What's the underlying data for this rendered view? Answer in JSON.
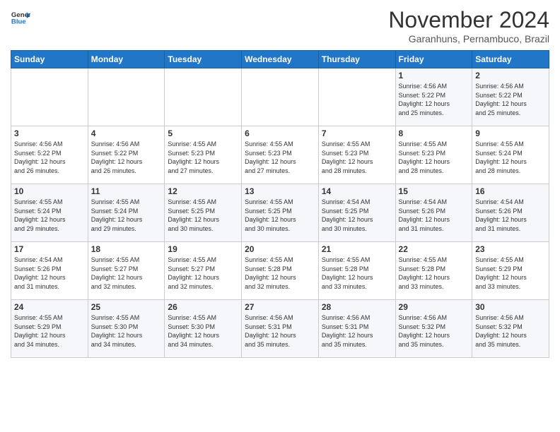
{
  "header": {
    "logo_line1": "General",
    "logo_line2": "Blue",
    "month": "November 2024",
    "location": "Garanhuns, Pernambuco, Brazil"
  },
  "weekdays": [
    "Sunday",
    "Monday",
    "Tuesday",
    "Wednesday",
    "Thursday",
    "Friday",
    "Saturday"
  ],
  "weeks": [
    [
      {
        "day": "",
        "info": ""
      },
      {
        "day": "",
        "info": ""
      },
      {
        "day": "",
        "info": ""
      },
      {
        "day": "",
        "info": ""
      },
      {
        "day": "",
        "info": ""
      },
      {
        "day": "1",
        "info": "Sunrise: 4:56 AM\nSunset: 5:22 PM\nDaylight: 12 hours\nand 25 minutes."
      },
      {
        "day": "2",
        "info": "Sunrise: 4:56 AM\nSunset: 5:22 PM\nDaylight: 12 hours\nand 25 minutes."
      }
    ],
    [
      {
        "day": "3",
        "info": "Sunrise: 4:56 AM\nSunset: 5:22 PM\nDaylight: 12 hours\nand 26 minutes."
      },
      {
        "day": "4",
        "info": "Sunrise: 4:56 AM\nSunset: 5:22 PM\nDaylight: 12 hours\nand 26 minutes."
      },
      {
        "day": "5",
        "info": "Sunrise: 4:55 AM\nSunset: 5:23 PM\nDaylight: 12 hours\nand 27 minutes."
      },
      {
        "day": "6",
        "info": "Sunrise: 4:55 AM\nSunset: 5:23 PM\nDaylight: 12 hours\nand 27 minutes."
      },
      {
        "day": "7",
        "info": "Sunrise: 4:55 AM\nSunset: 5:23 PM\nDaylight: 12 hours\nand 28 minutes."
      },
      {
        "day": "8",
        "info": "Sunrise: 4:55 AM\nSunset: 5:23 PM\nDaylight: 12 hours\nand 28 minutes."
      },
      {
        "day": "9",
        "info": "Sunrise: 4:55 AM\nSunset: 5:24 PM\nDaylight: 12 hours\nand 28 minutes."
      }
    ],
    [
      {
        "day": "10",
        "info": "Sunrise: 4:55 AM\nSunset: 5:24 PM\nDaylight: 12 hours\nand 29 minutes."
      },
      {
        "day": "11",
        "info": "Sunrise: 4:55 AM\nSunset: 5:24 PM\nDaylight: 12 hours\nand 29 minutes."
      },
      {
        "day": "12",
        "info": "Sunrise: 4:55 AM\nSunset: 5:25 PM\nDaylight: 12 hours\nand 30 minutes."
      },
      {
        "day": "13",
        "info": "Sunrise: 4:55 AM\nSunset: 5:25 PM\nDaylight: 12 hours\nand 30 minutes."
      },
      {
        "day": "14",
        "info": "Sunrise: 4:54 AM\nSunset: 5:25 PM\nDaylight: 12 hours\nand 30 minutes."
      },
      {
        "day": "15",
        "info": "Sunrise: 4:54 AM\nSunset: 5:26 PM\nDaylight: 12 hours\nand 31 minutes."
      },
      {
        "day": "16",
        "info": "Sunrise: 4:54 AM\nSunset: 5:26 PM\nDaylight: 12 hours\nand 31 minutes."
      }
    ],
    [
      {
        "day": "17",
        "info": "Sunrise: 4:54 AM\nSunset: 5:26 PM\nDaylight: 12 hours\nand 31 minutes."
      },
      {
        "day": "18",
        "info": "Sunrise: 4:55 AM\nSunset: 5:27 PM\nDaylight: 12 hours\nand 32 minutes."
      },
      {
        "day": "19",
        "info": "Sunrise: 4:55 AM\nSunset: 5:27 PM\nDaylight: 12 hours\nand 32 minutes."
      },
      {
        "day": "20",
        "info": "Sunrise: 4:55 AM\nSunset: 5:28 PM\nDaylight: 12 hours\nand 32 minutes."
      },
      {
        "day": "21",
        "info": "Sunrise: 4:55 AM\nSunset: 5:28 PM\nDaylight: 12 hours\nand 33 minutes."
      },
      {
        "day": "22",
        "info": "Sunrise: 4:55 AM\nSunset: 5:28 PM\nDaylight: 12 hours\nand 33 minutes."
      },
      {
        "day": "23",
        "info": "Sunrise: 4:55 AM\nSunset: 5:29 PM\nDaylight: 12 hours\nand 33 minutes."
      }
    ],
    [
      {
        "day": "24",
        "info": "Sunrise: 4:55 AM\nSunset: 5:29 PM\nDaylight: 12 hours\nand 34 minutes."
      },
      {
        "day": "25",
        "info": "Sunrise: 4:55 AM\nSunset: 5:30 PM\nDaylight: 12 hours\nand 34 minutes."
      },
      {
        "day": "26",
        "info": "Sunrise: 4:55 AM\nSunset: 5:30 PM\nDaylight: 12 hours\nand 34 minutes."
      },
      {
        "day": "27",
        "info": "Sunrise: 4:56 AM\nSunset: 5:31 PM\nDaylight: 12 hours\nand 35 minutes."
      },
      {
        "day": "28",
        "info": "Sunrise: 4:56 AM\nSunset: 5:31 PM\nDaylight: 12 hours\nand 35 minutes."
      },
      {
        "day": "29",
        "info": "Sunrise: 4:56 AM\nSunset: 5:32 PM\nDaylight: 12 hours\nand 35 minutes."
      },
      {
        "day": "30",
        "info": "Sunrise: 4:56 AM\nSunset: 5:32 PM\nDaylight: 12 hours\nand 35 minutes."
      }
    ]
  ]
}
